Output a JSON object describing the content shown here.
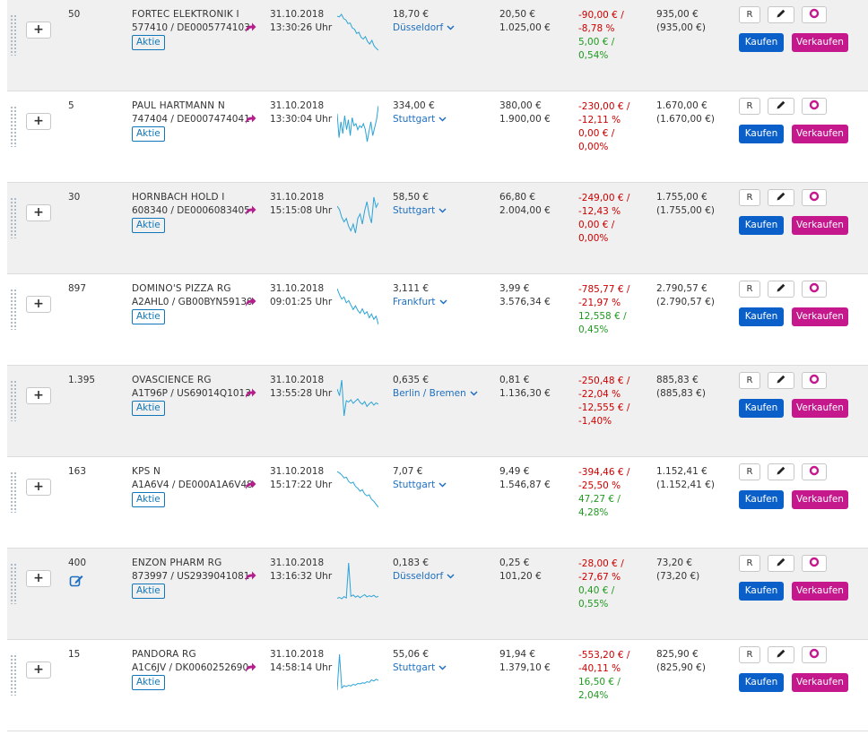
{
  "colors": {
    "link_blue": "#1e6fc0",
    "sparkline": "#2ba3d6",
    "negative_red": "#cc0000",
    "positive_green": "#1f9a1f",
    "buy_blue": "#0a60c8",
    "sell_magenta": "#c5188d",
    "share_icon_magenta": "#b51e8c"
  },
  "actions": {
    "plus": "+",
    "r": "R",
    "buy": "Kaufen",
    "sell": "Verkaufen"
  },
  "icons": {
    "drag": "drag-handle-icon",
    "share": "share-arrow-icon",
    "edit": "edit-note-icon",
    "pen": "pencil-icon",
    "ring": "circle-ring-icon",
    "chevron": "chevron-down-icon"
  },
  "positions": [
    {
      "qty": "50",
      "name": "FORTEC ELEKTRONIK I",
      "ids": "577410 / DE0005774103",
      "type": "Aktie",
      "date": "31.10.2018",
      "time": "13:30:26 Uhr",
      "sparkline": [
        18,
        17.9,
        18.3,
        17.6,
        17.4,
        16.8,
        16.9,
        16.1,
        15.9,
        15.2,
        15.4,
        14.6,
        14.3,
        14.7,
        13.9,
        13.5,
        14.1,
        13.2,
        12.8,
        12.5
      ],
      "price": "18,70 €",
      "exchange": "Düsseldorf",
      "buy_price": "20,50 €",
      "buy_value": "1.025,00 €",
      "perf": [
        "-90,00 € /",
        "-8,78 %",
        "5,00 € /",
        "0,54%"
      ],
      "perf_sign": [
        "neg",
        "neg",
        "pos",
        "pos"
      ],
      "value": "935,00 €",
      "value2": "(935,00 €)",
      "edit_note": false
    },
    {
      "qty": "5",
      "name": "PAUL HARTMANN N",
      "ids": "747404 / DE0007474041",
      "type": "Aktie",
      "date": "31.10.2018",
      "time": "13:30:04 Uhr",
      "sparkline": [
        20,
        8,
        16,
        10,
        19,
        12,
        17,
        9,
        18,
        14,
        15,
        12,
        14,
        13,
        15,
        12,
        6,
        11,
        16,
        9,
        13,
        17,
        24
      ],
      "price": "334,00 €",
      "exchange": "Stuttgart",
      "buy_price": "380,00 €",
      "buy_value": "1.900,00 €",
      "perf": [
        "-230,00 € /",
        "-12,11 %",
        "0,00 € /",
        "0,00%"
      ],
      "perf_sign": [
        "neg",
        "neg",
        "neg",
        "neg"
      ],
      "value": "1.670,00 €",
      "value2": "(1.670,00 €)",
      "edit_note": false
    },
    {
      "qty": "30",
      "name": "HORNBACH HOLD I",
      "ids": "608340 / DE0006083405",
      "type": "Aktie",
      "date": "31.10.2018",
      "time": "15:15:08 Uhr",
      "sparkline": [
        12,
        11.7,
        11,
        10.6,
        10.9,
        10.2,
        9.8,
        10.4,
        9.6,
        10.9,
        11.3,
        10.4,
        11.6,
        12.4,
        11.2,
        10.5,
        12.8,
        11.9,
        12.3
      ],
      "price": "58,50 €",
      "exchange": "Stuttgart",
      "buy_price": "66,80 €",
      "buy_value": "2.004,00 €",
      "perf": [
        "-249,00 € /",
        "-12,43 %",
        "0,00 € /",
        "0,00%"
      ],
      "perf_sign": [
        "neg",
        "neg",
        "neg",
        "neg"
      ],
      "value": "1.755,00 €",
      "value2": "(1.755,00 €)",
      "edit_note": false
    },
    {
      "qty": "897",
      "name": "DOMINO'S PIZZA RG",
      "ids": "A2AHL0 / GB00BYN59130",
      "type": "Aktie",
      "date": "31.10.2018",
      "time": "09:01:25 Uhr",
      "sparkline": [
        14,
        13.2,
        12.6,
        12.9,
        12.1,
        12.4,
        11.8,
        11.2,
        11.7,
        11.1,
        10.7,
        11.3,
        10.6,
        10.9,
        10.1,
        10.6,
        9.9,
        10.3,
        9.2
      ],
      "price": "3,111 €",
      "exchange": "Frankfurt",
      "buy_price": "3,99 €",
      "buy_value": "3.576,34 €",
      "perf": [
        "-785,77 € /",
        "-21,97 %",
        "12,558 € /",
        "0,45%"
      ],
      "perf_sign": [
        "neg",
        "neg",
        "pos",
        "pos"
      ],
      "value": "2.790,57 €",
      "value2": "(2.790,57 €)",
      "edit_note": false
    },
    {
      "qty": "1.395",
      "name": "OVASCIENCE RG",
      "ids": "A1T96P / US69014Q1013",
      "type": "Aktie",
      "date": "31.10.2018",
      "time": "13:55:28 Uhr",
      "sparkline": [
        12,
        10.5,
        14,
        6,
        9.4,
        9.1,
        9.6,
        8.8,
        9.3,
        9.8,
        9.0,
        8.6,
        9.2,
        8.1,
        8.7,
        9.1,
        8.4,
        8.9,
        8.6
      ],
      "price": "0,635 €",
      "exchange": "Berlin / Bremen",
      "buy_price": "0,81 €",
      "buy_value": "1.136,30 €",
      "perf": [
        "-250,48 € /",
        "-22,04 %",
        "-12,555 € /",
        "-1,40%"
      ],
      "perf_sign": [
        "neg",
        "neg",
        "neg",
        "neg"
      ],
      "value": "885,83 €",
      "value2": "(885,83 €)",
      "edit_note": false
    },
    {
      "qty": "163",
      "name": "KPS N",
      "ids": "A1A6V4 / DE000A1A6V48",
      "type": "Aktie",
      "date": "31.10.2018",
      "time": "15:17:22 Uhr",
      "sparkline": [
        19,
        18.6,
        18.1,
        17.3,
        17.5,
        16.4,
        15.9,
        16.2,
        15.1,
        14.6,
        13.8,
        14.2,
        13.1,
        12.6,
        12.9,
        11.7,
        11.2,
        10.4,
        9.6
      ],
      "price": "7,07 €",
      "exchange": "Stuttgart",
      "buy_price": "9,49 €",
      "buy_value": "1.546,87 €",
      "perf": [
        "-394,46 € /",
        "-25,50 %",
        "47,27 € /",
        "4,28%"
      ],
      "perf_sign": [
        "neg",
        "neg",
        "pos",
        "pos"
      ],
      "value": "1.152,41 €",
      "value2": "(1.152,41 €)",
      "edit_note": false
    },
    {
      "qty": "400",
      "name": "ENZON PHARM RG",
      "ids": "873997 / US2939041081",
      "type": "Aktie",
      "date": "31.10.2018",
      "time": "13:16:32 Uhr",
      "sparkline": [
        9,
        9.3,
        8.8,
        9.6,
        9.1,
        22,
        9.7,
        10.2,
        9.4,
        9.9,
        9.2,
        9.8,
        10.3,
        9.5,
        9.9,
        9.6,
        10.1,
        9.4,
        9.7
      ],
      "price": "0,183 €",
      "exchange": "Düsseldorf",
      "buy_price": "0,25 €",
      "buy_value": "101,20 €",
      "perf": [
        "-28,00 € /",
        "-27,67 %",
        "0,40 € /",
        "0,55%"
      ],
      "perf_sign": [
        "neg",
        "neg",
        "pos",
        "pos"
      ],
      "value": "73,20 €",
      "value2": "(73,20 €)",
      "edit_note": true
    },
    {
      "qty": "15",
      "name": "PANDORA RG",
      "ids": "A1C6JV / DK0060252690",
      "type": "Aktie",
      "date": "31.10.2018",
      "time": "14:58:14 Uhr",
      "sparkline": [
        6,
        22,
        7,
        8,
        7.6,
        8.2,
        7.9,
        8.6,
        8.3,
        9.0,
        8.8,
        9.3,
        9.1,
        9.8,
        9.5,
        10.6,
        10.1,
        10.9,
        10.4
      ],
      "price": "55,06 €",
      "exchange": "Stuttgart",
      "buy_price": "91,94 €",
      "buy_value": "1.379,10 €",
      "perf": [
        "-553,20 € /",
        "-40,11 %",
        "16,50 € /",
        "2,04%"
      ],
      "perf_sign": [
        "neg",
        "neg",
        "pos",
        "pos"
      ],
      "value": "825,90 €",
      "value2": "(825,90 €)",
      "edit_note": false
    }
  ]
}
